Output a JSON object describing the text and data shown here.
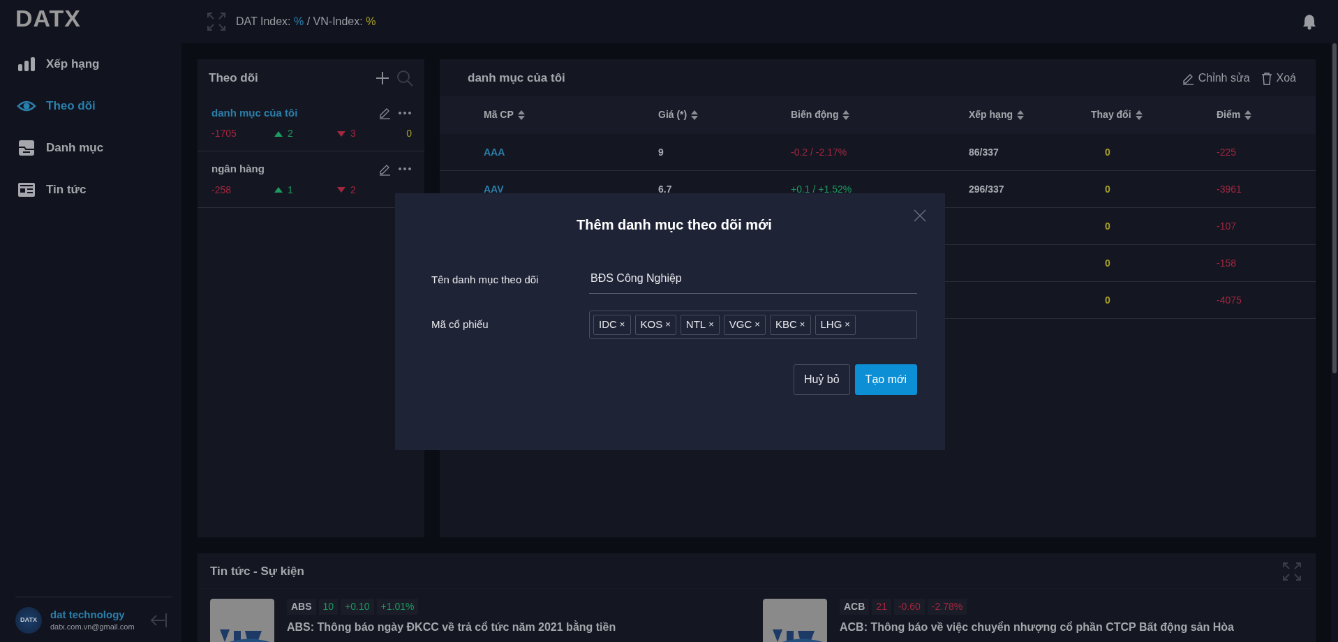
{
  "header": {
    "logo": "DATX",
    "index_label_1": "DAT Index:",
    "index_value_1": "%",
    "separator": "/",
    "index_label_2": "VN-Index:",
    "index_value_2": "%"
  },
  "sidebar": {
    "items": [
      {
        "label": "Xếp hạng",
        "selected": false
      },
      {
        "label": "Theo dõi",
        "selected": true
      },
      {
        "label": "Danh mục",
        "selected": false
      },
      {
        "label": "Tin tức",
        "selected": false
      }
    ],
    "user": {
      "avatar": "DATX",
      "name": "dat technology",
      "email": "datx.com.vn@gmail.com"
    }
  },
  "watchlists": {
    "title": "Theo dõi",
    "items": [
      {
        "name": "danh mục của tôi",
        "selected": true,
        "score": "-1705",
        "up": "2",
        "down": "3",
        "unchanged": "0"
      },
      {
        "name": "ngân hàng",
        "selected": false,
        "score": "-258",
        "up": "1",
        "down": "2"
      }
    ]
  },
  "portfolio": {
    "title": "danh mục của tôi",
    "actions": [
      {
        "label": "Chỉnh sửa",
        "kind": "edit"
      },
      {
        "label": "Xoá",
        "kind": "delete"
      }
    ],
    "table": {
      "columns": [
        "Mã CP",
        "Giá (*)",
        "Biến động",
        "Xếp hạng",
        "Thay đổi",
        "Điểm"
      ],
      "rows": [
        {
          "ticker": "AAA",
          "price": "9",
          "change": "-0.2 / -2.17%",
          "rising": false,
          "rank": "86/337",
          "delta": "0",
          "score": "-225"
        },
        {
          "ticker": "AAV",
          "price": "6.7",
          "change": "+0.1 / +1.52%",
          "rising": true,
          "rank": "296/337",
          "delta": "0",
          "score": "-3961"
        },
        {
          "delta": "0",
          "score": "-107"
        },
        {
          "delta": "0",
          "score": "-158"
        },
        {
          "delta": "0",
          "score": "-4075"
        }
      ]
    }
  },
  "news": {
    "title": "Tin tức - Sự kiện",
    "items": [
      {
        "ticker": "ABS",
        "price": "10",
        "change": "+0.10",
        "percent": "+1.01%",
        "rising": true,
        "headline": "ABS: Thông báo ngày ĐKCC về trả cổ tức năm 2021 bằng tiền"
      },
      {
        "ticker": "ACB",
        "price": "21",
        "change": "-0.60",
        "percent": "-2.78%",
        "rising": false,
        "headline": "ACB: Thông báo về việc chuyển nhượng cổ phần CTCP Bất động sản Hòa"
      }
    ]
  },
  "modal": {
    "title": "Thêm danh mục theo dõi mới",
    "name_label": "Tên danh mục theo dõi",
    "name_value": "BĐS Công Nghiệp",
    "tickers_label": "Mã cổ phiếu",
    "tickers": [
      "IDC",
      "KOS",
      "NTL",
      "VGC",
      "KBC",
      "LHG"
    ],
    "remove_glyph": "×",
    "buttons": [
      {
        "label": "Huỷ bỏ",
        "kind": "secondary"
      },
      {
        "label": "Tạo mới",
        "kind": "primary"
      }
    ]
  }
}
